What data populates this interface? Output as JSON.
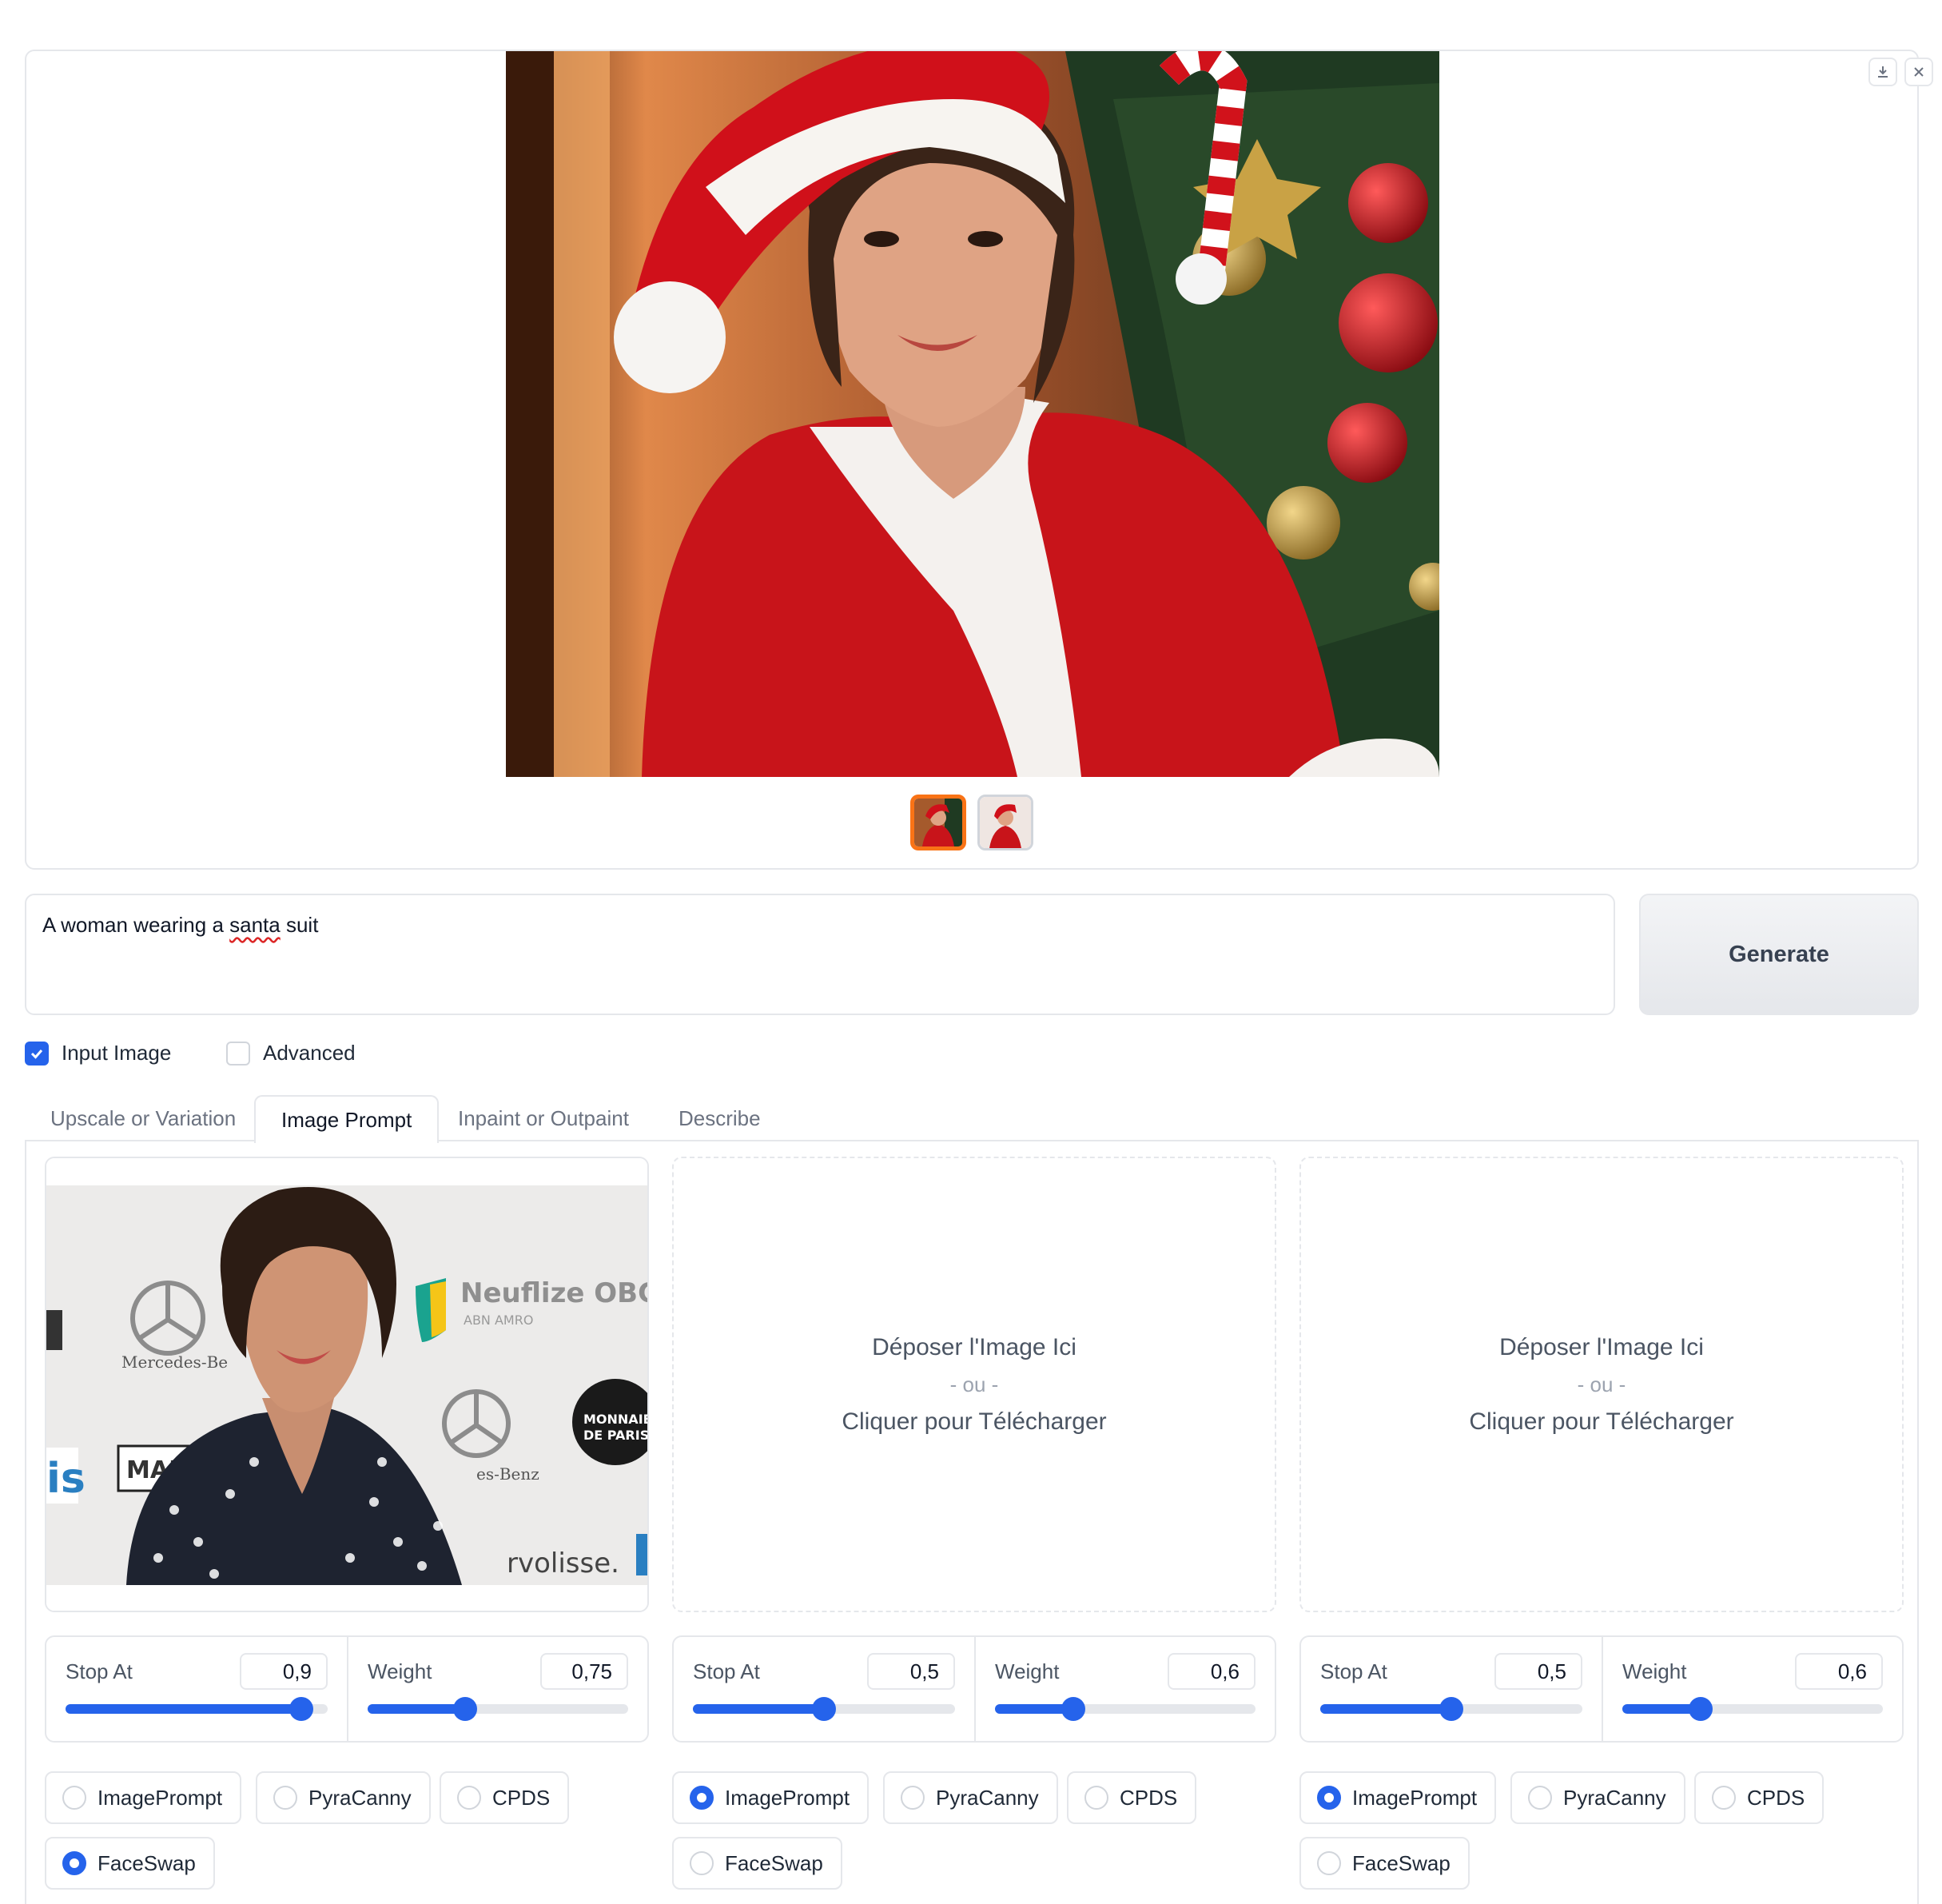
{
  "gallery": {
    "download_icon": "download-icon",
    "close_icon": "close-icon",
    "thumbnails": 2
  },
  "prompt": {
    "text_before": "A woman wearing a ",
    "text_misspelled": "santa",
    "text_after": " suit"
  },
  "generate_label": "Generate",
  "options": {
    "input_image": {
      "label": "Input Image",
      "checked": true
    },
    "advanced": {
      "label": "Advanced",
      "checked": false
    }
  },
  "tabs": [
    "Upscale or Variation",
    "Image Prompt",
    "Inpaint or Outpaint",
    "Describe"
  ],
  "active_tab": "Image Prompt",
  "drop_text": {
    "line1": "Déposer l'Image Ici",
    "line2": "- ou -",
    "line3": "Cliquer pour Télécharger"
  },
  "image_prompts": [
    {
      "stop_at": {
        "label": "Stop At",
        "value": "0,9",
        "fraction": 0.9
      },
      "weight": {
        "label": "Weight",
        "value": "0,75",
        "fraction": 0.375
      },
      "types": [
        "ImagePrompt",
        "PyraCanny",
        "CPDS",
        "FaceSwap"
      ],
      "selected": "FaceSwap",
      "image_text": {
        "brand": "Neuflize OBC",
        "brand_sub": "ABN AMRO",
        "mercedes": "Mercedes-Be",
        "benz": "es-Benz",
        "marc": "MARC",
        "monnaie": "MONNAIE",
        "deparis": "DE PARIS",
        "volisse": "rvolisse.",
        "iis": "is"
      }
    },
    {
      "stop_at": {
        "label": "Stop At",
        "value": "0,5",
        "fraction": 0.5
      },
      "weight": {
        "label": "Weight",
        "value": "0,6",
        "fraction": 0.3
      },
      "types": [
        "ImagePrompt",
        "PyraCanny",
        "CPDS",
        "FaceSwap"
      ],
      "selected": "ImagePrompt"
    },
    {
      "stop_at": {
        "label": "Stop At",
        "value": "0,5",
        "fraction": 0.5
      },
      "weight": {
        "label": "Weight",
        "value": "0,6",
        "fraction": 0.3
      },
      "types": [
        "ImagePrompt",
        "PyraCanny",
        "CPDS",
        "FaceSwap"
      ],
      "selected": "ImagePrompt"
    }
  ],
  "colors": {
    "accent": "#2563eb",
    "thumb_active": "#f97316",
    "border": "#e5e7eb"
  }
}
